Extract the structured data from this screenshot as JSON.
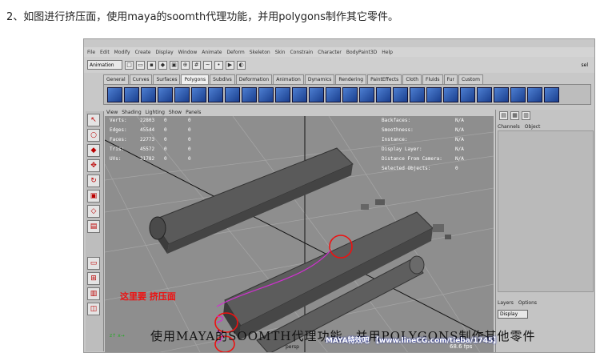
{
  "caption": "2、如图进行挤压面，使用maya的soomth代理功能，并用polygons制作其它零件。",
  "menu": [
    "File",
    "Edit",
    "Modify",
    "Create",
    "Display",
    "Window",
    "Animate",
    "Deform",
    "Skeleton",
    "Skin",
    "Constrain",
    "Character",
    "BodyPaint3D",
    "Help"
  ],
  "mode_menu": "Animation",
  "shelf_tabs": [
    "General",
    "Curves",
    "Surfaces",
    "Polygons",
    "Subdivs",
    "Deformation",
    "Animation",
    "Dynamics",
    "Rendering",
    "PaintEffects",
    "Cloth",
    "Fluids",
    "Fur",
    "Custom"
  ],
  "active_shelf_tab": "Polygons",
  "panel_menu": [
    "View",
    "Shading",
    "Lighting",
    "Show",
    "Panels"
  ],
  "hud_left": [
    {
      "k": "Verts:",
      "a": "22803",
      "b": "0",
      "c": "0"
    },
    {
      "k": "Edges:",
      "a": "45544",
      "b": "0",
      "c": "0"
    },
    {
      "k": "Faces:",
      "a": "22773",
      "b": "0",
      "c": "0"
    },
    {
      "k": "Tris:",
      "a": "45572",
      "b": "0",
      "c": "0"
    },
    {
      "k": "UVs:",
      "a": "31782",
      "b": "0",
      "c": "0"
    }
  ],
  "hud_right": [
    {
      "k": "Backfaces:",
      "v": "N/A"
    },
    {
      "k": "Smoothness:",
      "v": "N/A"
    },
    {
      "k": "Instance:",
      "v": "N/A"
    },
    {
      "k": "Display Layer:",
      "v": "N/A"
    },
    {
      "k": "Distance From Camera:",
      "v": "N/A"
    },
    {
      "k": "Selected Objects:",
      "v": "0"
    }
  ],
  "channel_box": {
    "channels": "Channels",
    "object": "Object"
  },
  "layers": {
    "layers": "Layers",
    "options": "Options",
    "display": "Display"
  },
  "annotation": "这里要 挤压面",
  "subtitle": "使用MAYA的SOOMTH代理功能，并用POLYGONS制作其他零件",
  "camera": "persp",
  "fps": "68.6 fps",
  "watermark": "MAYA特效吧 【www.lineCG.com/tieba/1745】",
  "mode_set_label": "sel",
  "colors": {
    "accent": "#e11",
    "viewport": "#8e8e8e",
    "shelf_icon": "#2f5db3"
  }
}
